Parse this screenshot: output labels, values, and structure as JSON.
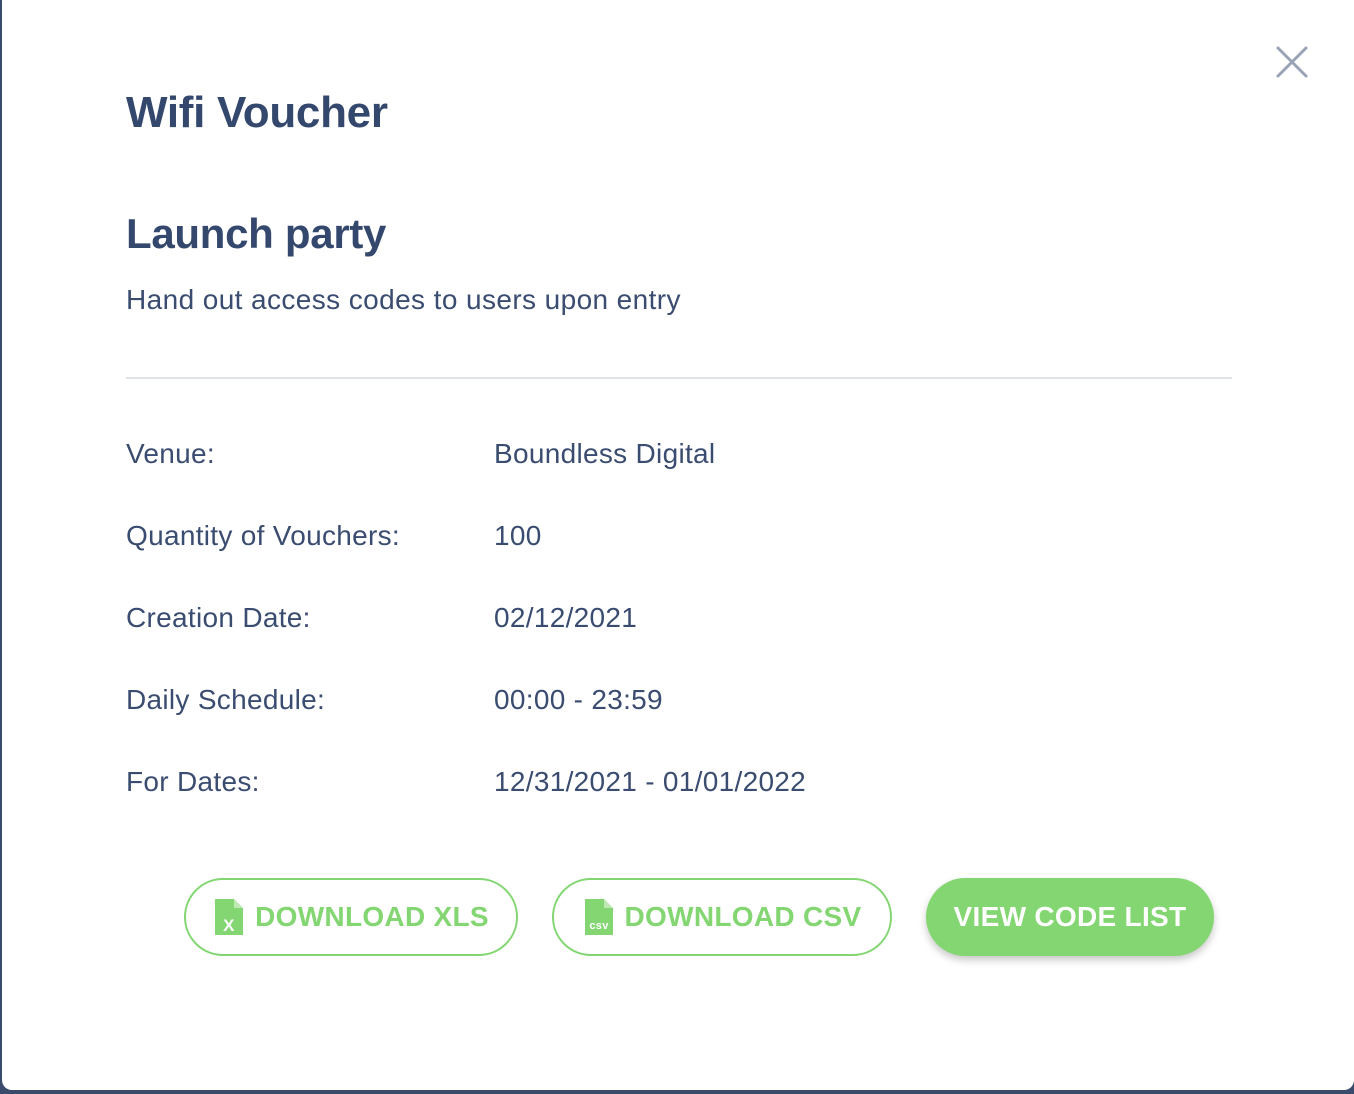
{
  "modal": {
    "title": "Wifi Voucher",
    "close_icon": "close-icon"
  },
  "voucher": {
    "name": "Launch party",
    "description": "Hand out access codes to users upon entry"
  },
  "details": [
    {
      "label": "Venue:",
      "value": "Boundless Digital"
    },
    {
      "label": "Quantity of Vouchers:",
      "value": "100"
    },
    {
      "label": "Creation Date:",
      "value": "02/12/2021"
    },
    {
      "label": "Daily Schedule:",
      "value": "00:00 - 23:59"
    },
    {
      "label": "For Dates:",
      "value": "12/31/2021 - 01/01/2022"
    }
  ],
  "actions": {
    "download_xls": {
      "label": "DOWNLOAD XLS",
      "icon": "xls-file-icon",
      "icon_text": "X"
    },
    "download_csv": {
      "label": "DOWNLOAD CSV",
      "icon": "csv-file-icon",
      "icon_text": "csv"
    },
    "view_code_list": {
      "label": "VIEW CODE LIST"
    }
  },
  "colors": {
    "heading": "#34486e",
    "text": "#3a4c70",
    "accent_green": "#84d672",
    "close_icon": "#9aa3b5",
    "divider": "#dfe2e7"
  }
}
